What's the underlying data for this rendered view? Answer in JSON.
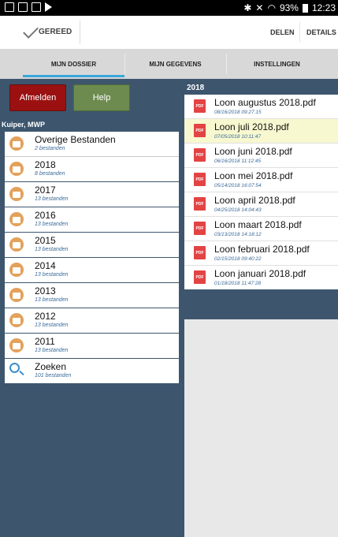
{
  "status": {
    "battery": "93%",
    "time": "12:23"
  },
  "actionbar": {
    "done_label": "GEREED",
    "share_label": "DELEN",
    "details_label": "DETAILS"
  },
  "tabs": [
    {
      "label": "MIJN DOSSIER"
    },
    {
      "label": "MIJN GEGEVENS"
    },
    {
      "label": "INSTELLINGEN"
    }
  ],
  "left": {
    "logout_label": "Afmelden",
    "help_label": "Help",
    "user": "Kuiper, MWP",
    "folders": [
      {
        "title": "Overige Bestanden",
        "count": "2 bestanden"
      },
      {
        "title": "2018",
        "count": "8 bestanden"
      },
      {
        "title": "2017",
        "count": "13 bestanden"
      },
      {
        "title": "2016",
        "count": "13 bestanden"
      },
      {
        "title": "2015",
        "count": "13 bestanden"
      },
      {
        "title": "2014",
        "count": "13 bestanden"
      },
      {
        "title": "2013",
        "count": "13 bestanden"
      },
      {
        "title": "2012",
        "count": "13 bestanden"
      },
      {
        "title": "2011",
        "count": "13 bestanden"
      },
      {
        "title": "Zoeken",
        "count": "101 bestanden"
      }
    ]
  },
  "right": {
    "year": "2018",
    "pdf_icon_label": "PDF",
    "files": [
      {
        "title": "Loon augustus 2018.pdf",
        "date": "08/16/2018 09:27:15"
      },
      {
        "title": "Loon juli 2018.pdf",
        "date": "07/05/2018 10:11:47"
      },
      {
        "title": "Loon juni 2018.pdf",
        "date": "06/16/2018 11:12:45"
      },
      {
        "title": "Loon mei 2018.pdf",
        "date": "05/14/2018 16:07:54"
      },
      {
        "title": "Loon april 2018.pdf",
        "date": "04/25/2018 14:04:43"
      },
      {
        "title": "Loon maart 2018.pdf",
        "date": "03/13/2018 14:18:12"
      },
      {
        "title": "Loon februari 2018.pdf",
        "date": "02/15/2018 09:40:22"
      },
      {
        "title": "Loon januari 2018.pdf",
        "date": "01/18/2018 11:47:28"
      }
    ]
  }
}
